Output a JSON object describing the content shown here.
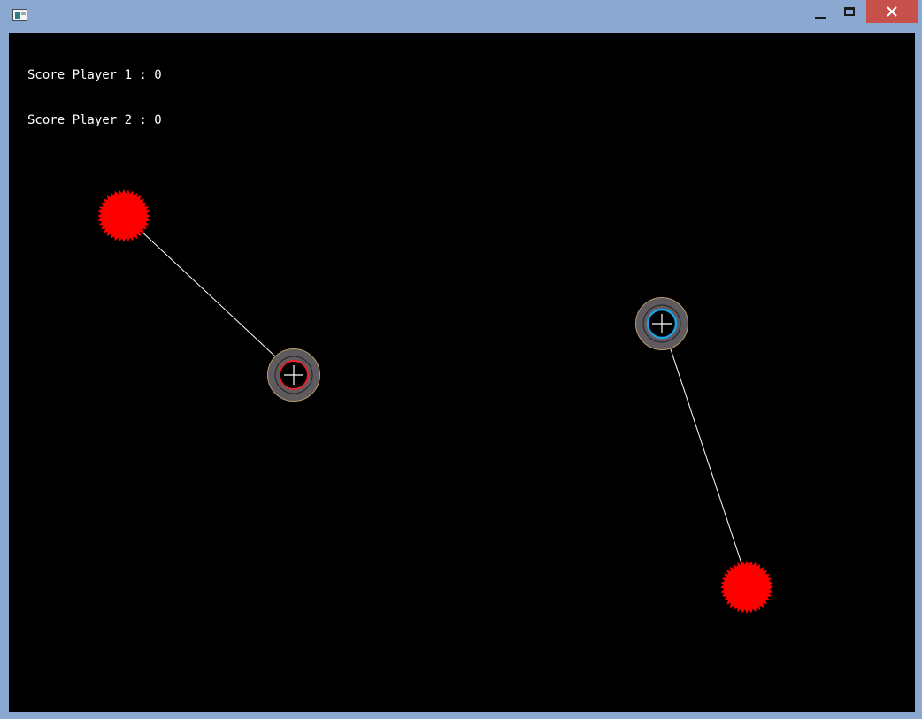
{
  "window": {
    "icon": "app-window-icon",
    "controls": {
      "minimize_icon": "minimize-icon",
      "maximize_icon": "maximize-icon",
      "close_icon": "close-icon"
    }
  },
  "hud": {
    "score_player_1_label": "Score Player 1 : ",
    "score_player_1_value": "0",
    "score_player_2_label": "Score Player 2 : ",
    "score_player_2_value": "0"
  },
  "colors": {
    "background": "#000000",
    "ball": "#ff0000",
    "tether": "#ffffff",
    "player_1_ring": "#e8202a",
    "player_2_ring": "#1aa3e8",
    "player_body": "#5e5a5e",
    "player_outline": "#b59a6a",
    "titlebar": "#8ba8d0",
    "close_button": "#c7504b"
  },
  "players": [
    {
      "id": "player-1",
      "accent": "player_1_ring"
    },
    {
      "id": "player-2",
      "accent": "player_2_ring"
    }
  ]
}
